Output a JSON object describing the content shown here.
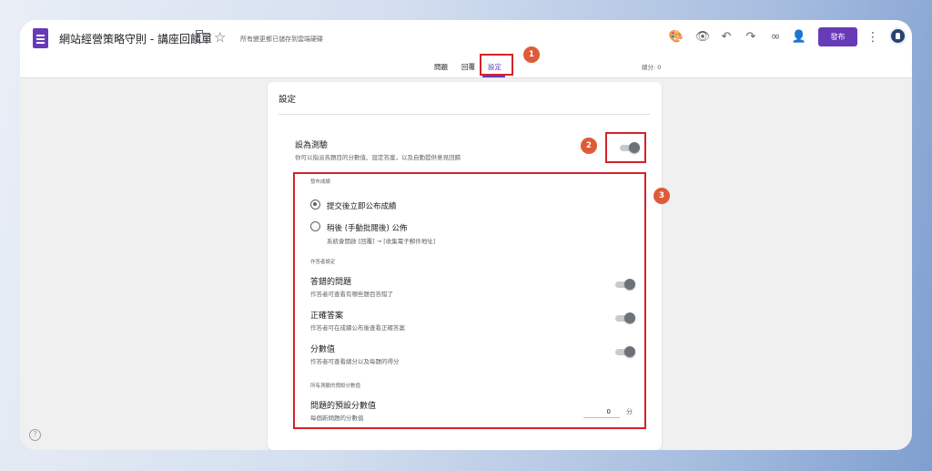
{
  "header": {
    "doc_title": "網站經營策略守則 - 講座回饋單",
    "save_status": "所有變更都已儲存到雲端硬碟",
    "publish_label": "發布",
    "star_glyph": "☆",
    "icons": [
      "forms-icon",
      "folder-icon",
      "star-icon",
      "palette-icon",
      "eye-icon",
      "undo-icon",
      "redo-icon",
      "link-icon",
      "add-person-icon",
      "more-vert-icon",
      "avatar"
    ]
  },
  "tabs": [
    {
      "label": "問題"
    },
    {
      "label": "回覆"
    },
    {
      "label": "設定",
      "active": true
    }
  ],
  "total_points": "總分: 0",
  "settings": {
    "heading": "設定",
    "quiz": {
      "title": "設為測驗",
      "description": "你可以指派各題目的分數值、設定答案，以及自動提供意見回饋",
      "enabled": true
    },
    "release_section": "發布成績",
    "release_options": [
      {
        "label": "提交後立即公布成績",
        "checked": true
      },
      {
        "label": "稍後 (手動批閱後) 公佈",
        "note": "系統會開啟 [回覆] → [收集電子郵件地址]",
        "checked": false
      }
    ],
    "respondent_section": "作答者設定",
    "respondent_options": [
      {
        "title": "答錯的問題",
        "description": "作答者可查看有哪些題目答錯了",
        "enabled": true
      },
      {
        "title": "正確答案",
        "description": "作答者可在成績公布後查看正確答案",
        "enabled": true
      },
      {
        "title": "分數值",
        "description": "作答者可查看總分以及每題的得分",
        "enabled": true
      }
    ],
    "default_points_section": "所有測驗的預設分數值",
    "default_points": {
      "title": "問題的預設分數值",
      "description": "每個新問題的分數值",
      "value": "0",
      "unit": "分"
    }
  },
  "annotations": {
    "marker_1": "1",
    "marker_2": "2",
    "marker_3": "3",
    "highlight_color": "#d3222a",
    "marker_color": "#de5b3a"
  },
  "colors": {
    "accent": "#673ab7"
  }
}
